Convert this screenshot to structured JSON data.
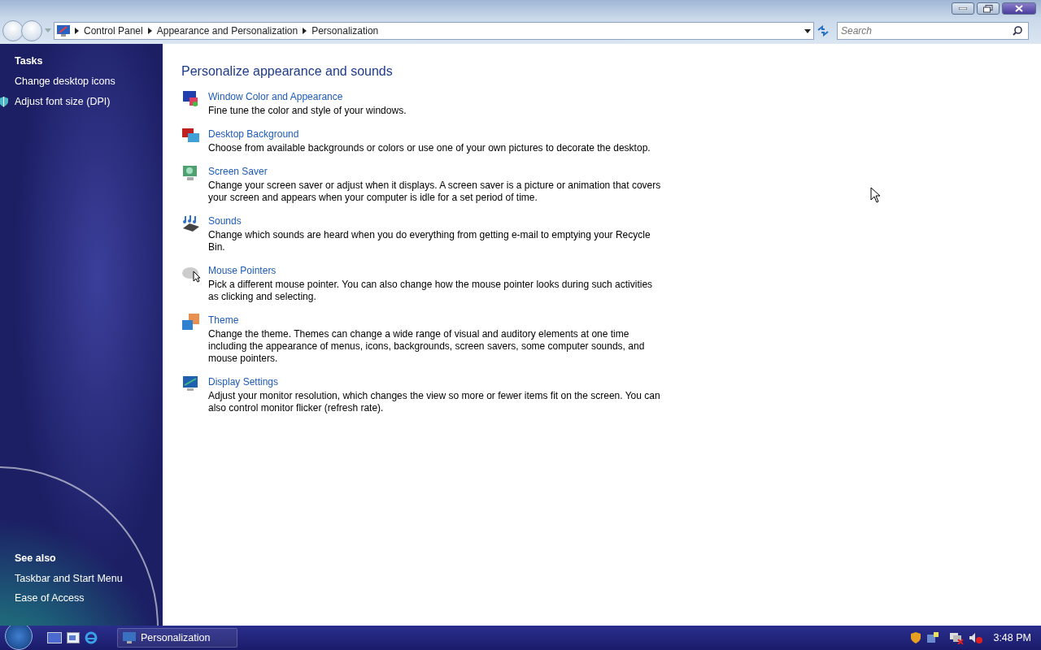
{
  "address_bar": {
    "breadcrumb": [
      "Control Panel",
      "Appearance and Personalization",
      "Personalization"
    ]
  },
  "search": {
    "placeholder": "Search"
  },
  "tasks": {
    "title": "Tasks",
    "items": [
      {
        "label": "Change desktop icons",
        "kind": "plain"
      },
      {
        "label": "Adjust font size (DPI)",
        "kind": "shield"
      }
    ]
  },
  "see_also": {
    "title": "See also",
    "items": [
      {
        "label": "Taskbar and Start Menu"
      },
      {
        "label": "Ease of Access"
      }
    ]
  },
  "content": {
    "heading": "Personalize appearance and sounds",
    "items": [
      {
        "kind": "window-color",
        "title": "Window Color and Appearance",
        "description": "Fine tune the color and style of your windows."
      },
      {
        "kind": "background",
        "title": "Desktop Background",
        "description": "Choose from available backgrounds or colors or use one of your own pictures to decorate the desktop."
      },
      {
        "kind": "screensaver",
        "title": "Screen Saver",
        "description": "Change your screen saver or adjust when it displays. A screen saver is a picture or animation that covers your screen and appears when your computer is idle for a set period of time."
      },
      {
        "kind": "sounds",
        "title": "Sounds",
        "description": "Change which sounds are heard when you do everything from getting e-mail to emptying your Recycle Bin."
      },
      {
        "kind": "mouse",
        "title": "Mouse Pointers",
        "description": "Pick a different mouse pointer. You can also change how the mouse pointer looks during such activities as clicking and selecting."
      },
      {
        "kind": "theme",
        "title": "Theme",
        "description": "Change the theme. Themes can change a wide range of visual and auditory elements at one time including the appearance of menus, icons, backgrounds, screen savers, some computer sounds, and mouse pointers."
      },
      {
        "kind": "display",
        "title": "Display Settings",
        "description": "Adjust your monitor resolution, which changes the view so more or fewer items fit on the screen. You can also control monitor flicker (refresh rate)."
      }
    ]
  },
  "taskbar": {
    "window_button": "Personalization",
    "clock": "3:48 PM"
  }
}
